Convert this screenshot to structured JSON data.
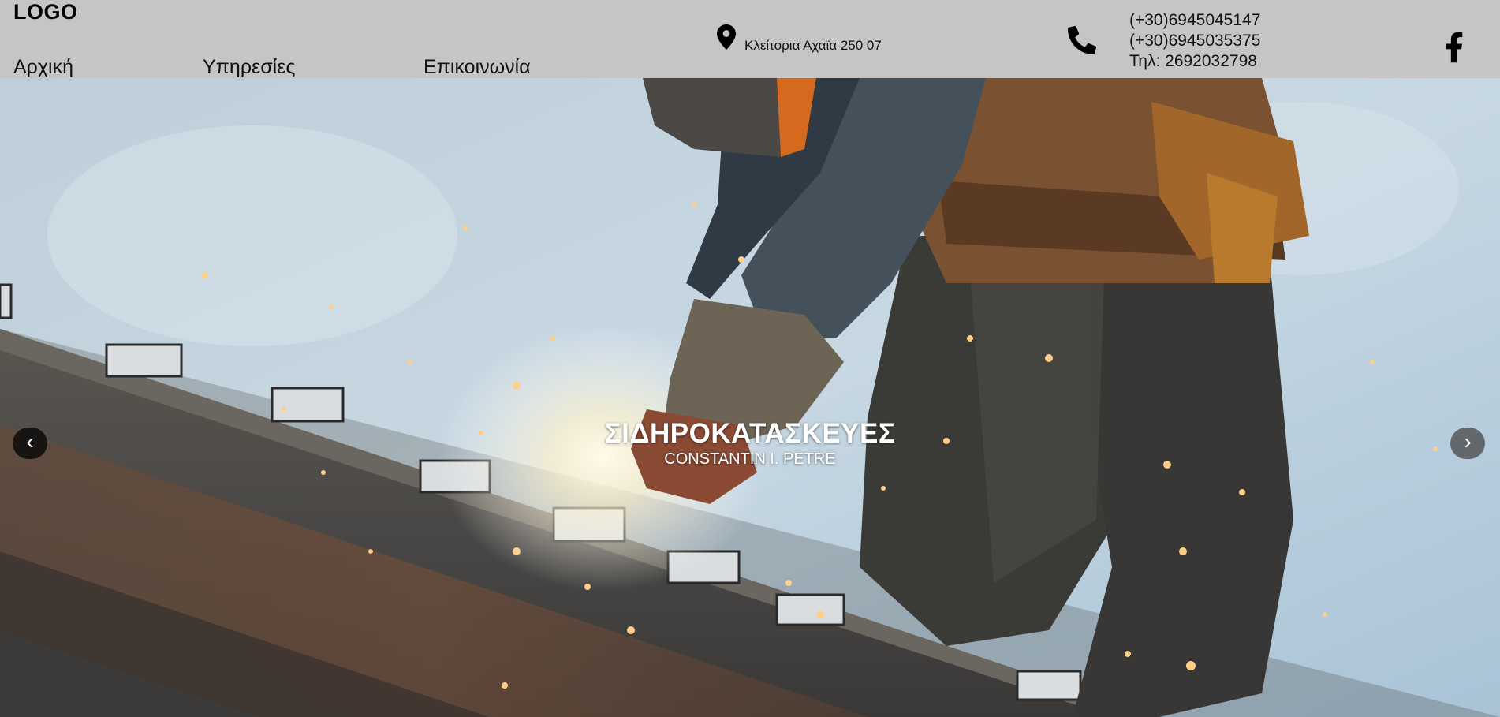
{
  "header": {
    "logo": "LOGO",
    "nav": [
      {
        "label": "Αρχική"
      },
      {
        "label": "Υπηρεσίες"
      },
      {
        "label": "Επικοινωνία"
      }
    ],
    "address": "Κλείτορια Αχαϊα 250 07",
    "phones": [
      "(+30)6945045147",
      "(+30)6945035375",
      "Τηλ: 2692032798"
    ],
    "icons": {
      "address": "map-pin-icon",
      "phone": "phone-icon",
      "social": "facebook-icon"
    }
  },
  "hero": {
    "title": "ΣΙΔΗΡΟΚΑΤΑΣΚΕΥΕΣ",
    "subtitle": "CONSTANTIN I. PETRE",
    "prev_label": "‹",
    "next_label": "›"
  },
  "colors": {
    "header_bg": "#c6c5c4",
    "sky": "#b9cfdc",
    "beam": "#4c4a48",
    "text_light": "#ffffff"
  }
}
